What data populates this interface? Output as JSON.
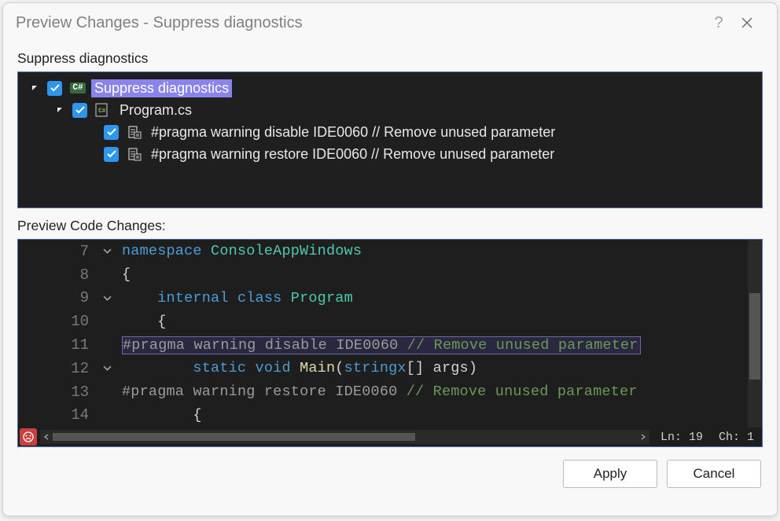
{
  "dialog": {
    "title": "Preview Changes - Suppress diagnostics"
  },
  "tree": {
    "label": "Suppress diagnostics",
    "root": "Suppress diagnostics",
    "file": "Program.cs",
    "item1": "#pragma warning disable IDE0060 // Remove unused parameter",
    "item2": "#pragma warning restore IDE0060 // Remove unused parameter"
  },
  "preview": {
    "label": "Preview Code Changes:",
    "status": {
      "line": "Ln: 19",
      "col": "Ch: 1"
    },
    "lines": [
      {
        "n": "7",
        "tokens": [
          [
            "kw",
            "namespace"
          ],
          [
            "",
            " "
          ],
          [
            "cls",
            "ConsoleAppWindows"
          ]
        ]
      },
      {
        "n": "8",
        "tokens": [
          [
            "",
            "{"
          ]
        ]
      },
      {
        "n": "9",
        "tokens": [
          [
            "",
            "    "
          ],
          [
            "kw",
            "internal"
          ],
          [
            "",
            " "
          ],
          [
            "kw",
            "class"
          ],
          [
            "",
            " "
          ],
          [
            "cls",
            "Program"
          ]
        ]
      },
      {
        "n": "10",
        "tokens": [
          [
            "",
            "    {"
          ]
        ]
      },
      {
        "n": "11",
        "tokens": [
          [
            "gy",
            "#pragma"
          ],
          [
            "",
            " "
          ],
          [
            "gy",
            "warning"
          ],
          [
            "",
            " "
          ],
          [
            "gy",
            "disable"
          ],
          [
            "",
            " "
          ],
          [
            "gy",
            "IDE0060"
          ],
          [
            "",
            " "
          ],
          [
            "cm",
            "// Remove unused parameter"
          ]
        ]
      },
      {
        "n": "12",
        "tokens": [
          [
            "",
            "        "
          ],
          [
            "kw",
            "static"
          ],
          [
            "",
            " "
          ],
          [
            "kw",
            "void"
          ],
          [
            "",
            " "
          ],
          [
            "mth",
            "Main"
          ],
          [
            "",
            "("
          ],
          [
            "kw",
            "stringx"
          ],
          [
            "",
            "[] "
          ],
          [
            "",
            "args"
          ],
          [
            "",
            ")"
          ]
        ]
      },
      {
        "n": "13",
        "tokens": [
          [
            "gy",
            "#pragma"
          ],
          [
            "",
            " "
          ],
          [
            "gy",
            "warning"
          ],
          [
            "",
            " "
          ],
          [
            "gy",
            "restore"
          ],
          [
            "",
            " "
          ],
          [
            "gy",
            "IDE0060"
          ],
          [
            "",
            " "
          ],
          [
            "cm",
            "// Remove unused parameter"
          ]
        ]
      },
      {
        "n": "14",
        "tokens": [
          [
            "",
            "        {"
          ]
        ]
      }
    ]
  },
  "buttons": {
    "apply": "Apply",
    "cancel": "Cancel"
  },
  "icons": {
    "cs": "C#"
  }
}
